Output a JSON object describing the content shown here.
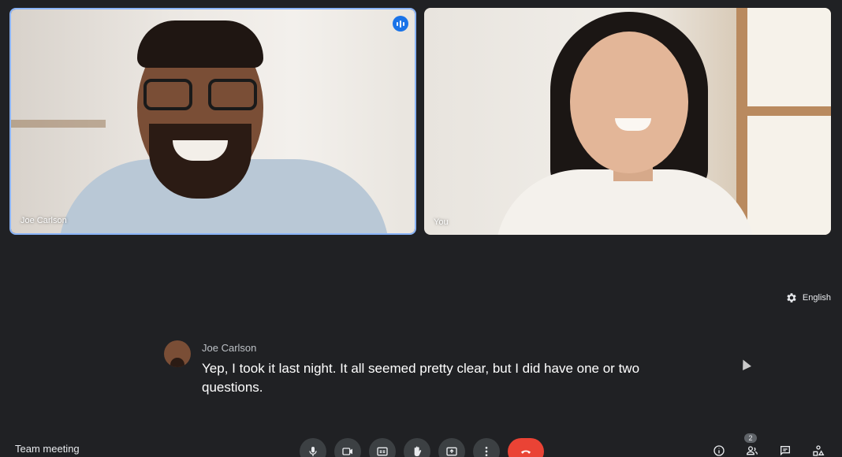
{
  "tiles": [
    {
      "name": "Joe Carlson",
      "speaking": true
    },
    {
      "name": "You"
    }
  ],
  "captions": {
    "language_label": "English",
    "speaker": "Joe Carlson",
    "text": "Yep, I took it last night. It all seemed pretty clear, but I did have one or two questions."
  },
  "bottom_bar": {
    "meeting_title": "Team meeting",
    "controls": [
      {
        "icon": "microphone-icon"
      },
      {
        "icon": "camera-icon"
      },
      {
        "icon": "captions-icon"
      },
      {
        "icon": "raise-hand-icon"
      },
      {
        "icon": "present-screen-icon"
      },
      {
        "icon": "more-options-icon"
      },
      {
        "icon": "end-call-icon"
      }
    ],
    "right_icons": [
      {
        "icon": "meeting-details-icon"
      },
      {
        "icon": "people-icon",
        "badge": "2"
      },
      {
        "icon": "chat-icon"
      },
      {
        "icon": "activities-icon"
      }
    ]
  },
  "colors": {
    "background": "#202124",
    "active_speaker_border": "#8ab4f8",
    "speaking_indicator": "#1a73e8",
    "end_call": "#ea4335",
    "control_button": "#3c4043"
  }
}
